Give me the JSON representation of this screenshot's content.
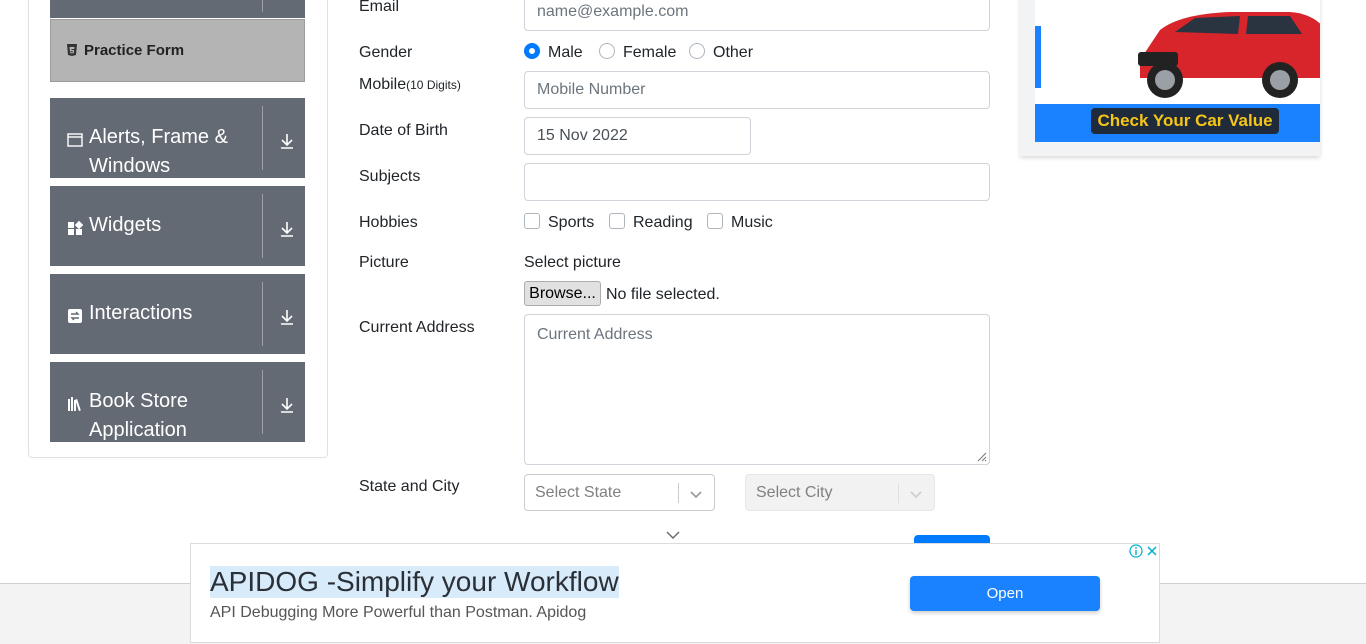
{
  "sidebar": {
    "active_item": "Practice Form",
    "groups": [
      {
        "label": "Alerts, Frame & Windows",
        "icon": "window-icon"
      },
      {
        "label": "Widgets",
        "icon": "widgets-icon"
      },
      {
        "label": "Interactions",
        "icon": "interactions-icon"
      },
      {
        "label": "Book Store Application",
        "icon": "books-icon"
      }
    ]
  },
  "form": {
    "email": {
      "label": "Email",
      "placeholder": "name@example.com"
    },
    "gender": {
      "label": "Gender",
      "options": [
        "Male",
        "Female",
        "Other"
      ],
      "selected": "Male"
    },
    "mobile": {
      "label": "Mobile",
      "hint": "(10 Digits)",
      "placeholder": "Mobile Number"
    },
    "dob": {
      "label": "Date of Birth",
      "value": "15 Nov 2022"
    },
    "subjects": {
      "label": "Subjects",
      "value": ""
    },
    "hobbies": {
      "label": "Hobbies",
      "options": [
        "Sports",
        "Reading",
        "Music"
      ]
    },
    "picture": {
      "label": "Picture",
      "select_text": "Select picture",
      "browse_label": "Browse...",
      "file_status": "No file selected."
    },
    "address": {
      "label": "Current Address",
      "placeholder": "Current Address"
    },
    "state_city": {
      "label": "State and City",
      "state_placeholder": "Select State",
      "city_placeholder": "Select City"
    }
  },
  "ad_right": {
    "cta": "Check Your Car Value"
  },
  "ad_bottom": {
    "title": "APIDOG -Simplify your Workflow",
    "subtitle": "API Debugging More Powerful than Postman. Apidog",
    "button": "Open"
  },
  "colors": {
    "sidebar_bg": "#646a73",
    "active_bg": "#b4b4b4",
    "primary": "#007bff",
    "ad_blue": "#1a82ff"
  }
}
